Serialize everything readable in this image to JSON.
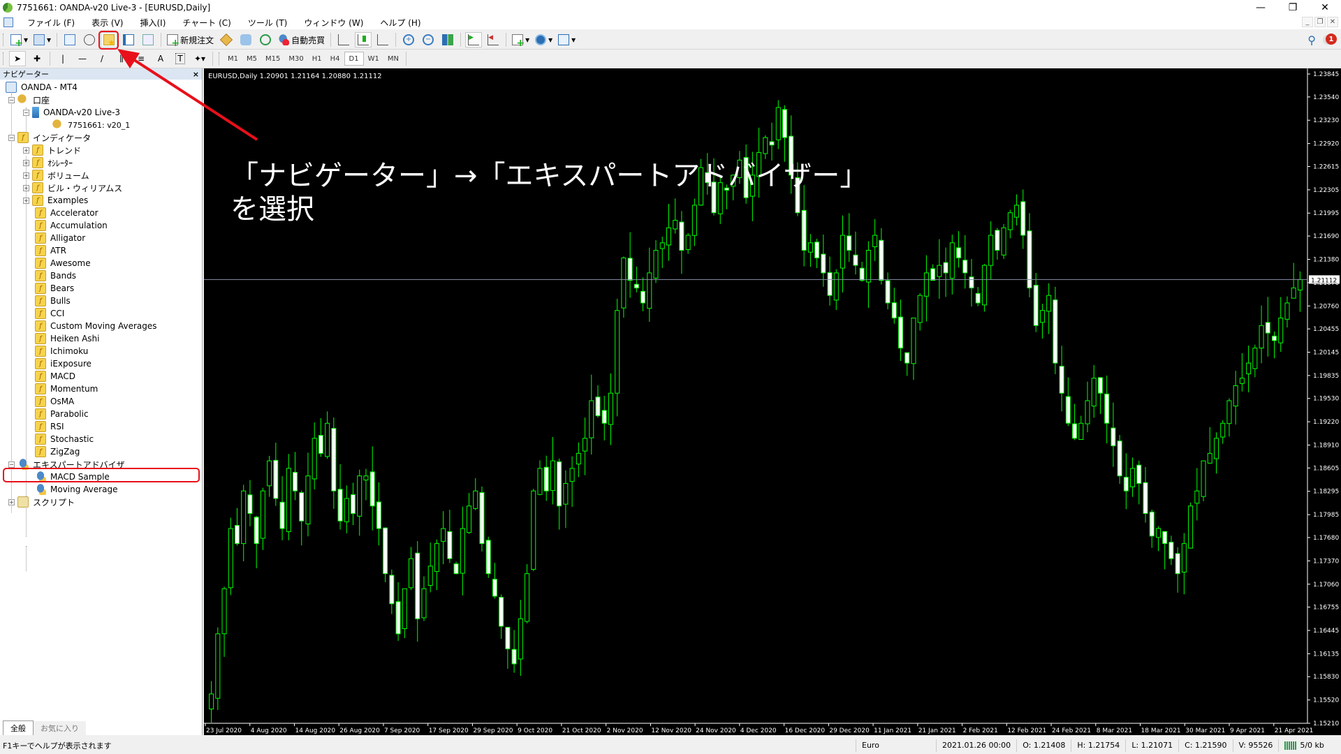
{
  "window": {
    "title": "7751661: OANDA-v20 Live-3 - [EURUSD,Daily]",
    "controls": [
      "minimize",
      "restore",
      "close"
    ]
  },
  "menu": [
    "ファイル (F)",
    "表示 (V)",
    "挿入(I)",
    "チャート (C)",
    "ツール (T)",
    "ウィンドウ (W)",
    "ヘルプ (H)"
  ],
  "toolbar": {
    "new_order_label": "新規注文",
    "auto_trade_label": "自動売買",
    "notification_count": "1"
  },
  "timeframes": [
    "M1",
    "M5",
    "M15",
    "M30",
    "H1",
    "H4",
    "D1",
    "W1",
    "MN"
  ],
  "active_timeframe": "D1",
  "navigator": {
    "title": "ナビゲーター",
    "close": "×",
    "root": "OANDA - MT4",
    "accounts_label": "口座",
    "server": "OANDA-v20 Live-3",
    "account": "7751661: v20_1",
    "indicators_label": "インディケータ",
    "indicator_groups": [
      "トレンド",
      "ｵｼﾚｰﾀｰ",
      "ボリューム",
      "ビル・ウィリアムス",
      "Examples"
    ],
    "indicators": [
      "Accelerator",
      "Accumulation",
      "Alligator",
      "ATR",
      "Awesome",
      "Bands",
      "Bears",
      "Bulls",
      "CCI",
      "Custom Moving Averages",
      "Heiken Ashi",
      "Ichimoku",
      "iExposure",
      "MACD",
      "Momentum",
      "OsMA",
      "Parabolic",
      "RSI",
      "Stochastic",
      "ZigZag"
    ],
    "experts_label": "エキスパートアドバイザ",
    "experts": [
      "MACD Sample",
      "Moving Average"
    ],
    "scripts_label": "スクリプト",
    "tabs": [
      "全般",
      "お気に入り"
    ]
  },
  "annotation": {
    "line1": "「ナビゲーター」→「エキスパートアドバイザー」",
    "line2": "を選択",
    "color": "#e8101a"
  },
  "chart_info": "EURUSD,Daily  1.20901 1.21164 1.20880 1.21112",
  "chart_data": {
    "type": "candlestick",
    "symbol": "EURUSD",
    "timeframe": "Daily",
    "current_price": 1.21112,
    "current_price_label": "1.21112",
    "ylim": [
      1.1521,
      1.23845
    ],
    "y_ticks": [
      "1.23845",
      "1.23540",
      "1.23230",
      "1.22920",
      "1.22615",
      "1.22305",
      "1.21995",
      "1.21690",
      "1.21380",
      "1.21070",
      "1.20760",
      "1.20455",
      "1.20145",
      "1.19835",
      "1.19530",
      "1.19220",
      "1.18910",
      "1.18605",
      "1.18295",
      "1.17985",
      "1.17680",
      "1.17370",
      "1.17060",
      "1.16755",
      "1.16445",
      "1.16135",
      "1.15830",
      "1.15520",
      "1.15210"
    ],
    "x_ticks": [
      "23 Jul 2020",
      "4 Aug 2020",
      "14 Aug 2020",
      "26 Aug 2020",
      "7 Sep 2020",
      "17 Sep 2020",
      "29 Sep 2020",
      "9 Oct 2020",
      "21 Oct 2020",
      "2 Nov 2020",
      "12 Nov 2020",
      "24 Nov 2020",
      "4 Dec 2020",
      "16 Dec 2020",
      "29 Dec 2020",
      "11 Jan 2021",
      "21 Jan 2021",
      "2 Feb 2021",
      "12 Feb 2021",
      "24 Feb 2021",
      "8 Mar 2021",
      "18 Mar 2021",
      "30 Mar 2021",
      "9 Apr 2021",
      "21 Apr 2021"
    ],
    "close_path": [
      1.156,
      1.164,
      1.17,
      1.178,
      1.176,
      1.183,
      1.18,
      1.176,
      1.183,
      1.187,
      1.182,
      1.178,
      1.186,
      1.183,
      1.179,
      1.185,
      1.19,
      1.188,
      1.192,
      1.183,
      1.179,
      1.182,
      1.18,
      1.185,
      1.185,
      1.181,
      1.178,
      1.172,
      1.168,
      1.164,
      1.17,
      1.174,
      1.166,
      1.17,
      1.173,
      1.176,
      1.178,
      1.174,
      1.172,
      1.178,
      1.181,
      1.183,
      1.176,
      1.172,
      1.169,
      1.165,
      1.162,
      1.16,
      1.166,
      1.172,
      1.183,
      1.186,
      1.183,
      1.187,
      1.181,
      1.184,
      1.186,
      1.188,
      1.19,
      1.195,
      1.193,
      1.192,
      1.196,
      1.207,
      1.214,
      1.211,
      1.21,
      1.208,
      1.212,
      1.215,
      1.216,
      1.218,
      1.219,
      1.215,
      1.217,
      1.221,
      1.226,
      1.224,
      1.22,
      1.224,
      1.223,
      1.225,
      1.227,
      1.222,
      1.225,
      1.228,
      1.23,
      1.229,
      1.234,
      1.23,
      1.225,
      1.22,
      1.215,
      1.216,
      1.214,
      1.212,
      1.209,
      1.212,
      1.217,
      1.215,
      1.213,
      1.211,
      1.215,
      1.217,
      1.211,
      1.208,
      1.206,
      1.202,
      1.2,
      1.206,
      1.209,
      1.212,
      1.211,
      1.213,
      1.212,
      1.216,
      1.214,
      1.212,
      1.21,
      1.208,
      1.213,
      1.217,
      1.215,
      1.218,
      1.22,
      1.221,
      1.217,
      1.21,
      1.205,
      1.207,
      1.209,
      1.2,
      1.196,
      1.192,
      1.19,
      1.192,
      1.195,
      1.198,
      1.196,
      1.192,
      1.189,
      1.185,
      1.183,
      1.186,
      1.184,
      1.18,
      1.177,
      1.178,
      1.176,
      1.174,
      1.172,
      1.176,
      1.181,
      1.183,
      1.187,
      1.188,
      1.19,
      1.192,
      1.195,
      1.197,
      1.198,
      1.2,
      1.202,
      1.205,
      1.204,
      1.203,
      1.206,
      1.208,
      1.21,
      1.2111
    ]
  },
  "status": {
    "help": "F1キーでヘルプが表示されます",
    "profile": "Euro",
    "datetime": "2021.01.26 00:00",
    "open": "O: 1.21408",
    "high": "H: 1.21754",
    "low": "L: 1.21071",
    "close": "C: 1.21590",
    "volume": "V: 95526",
    "traffic": "5/0 kb"
  }
}
